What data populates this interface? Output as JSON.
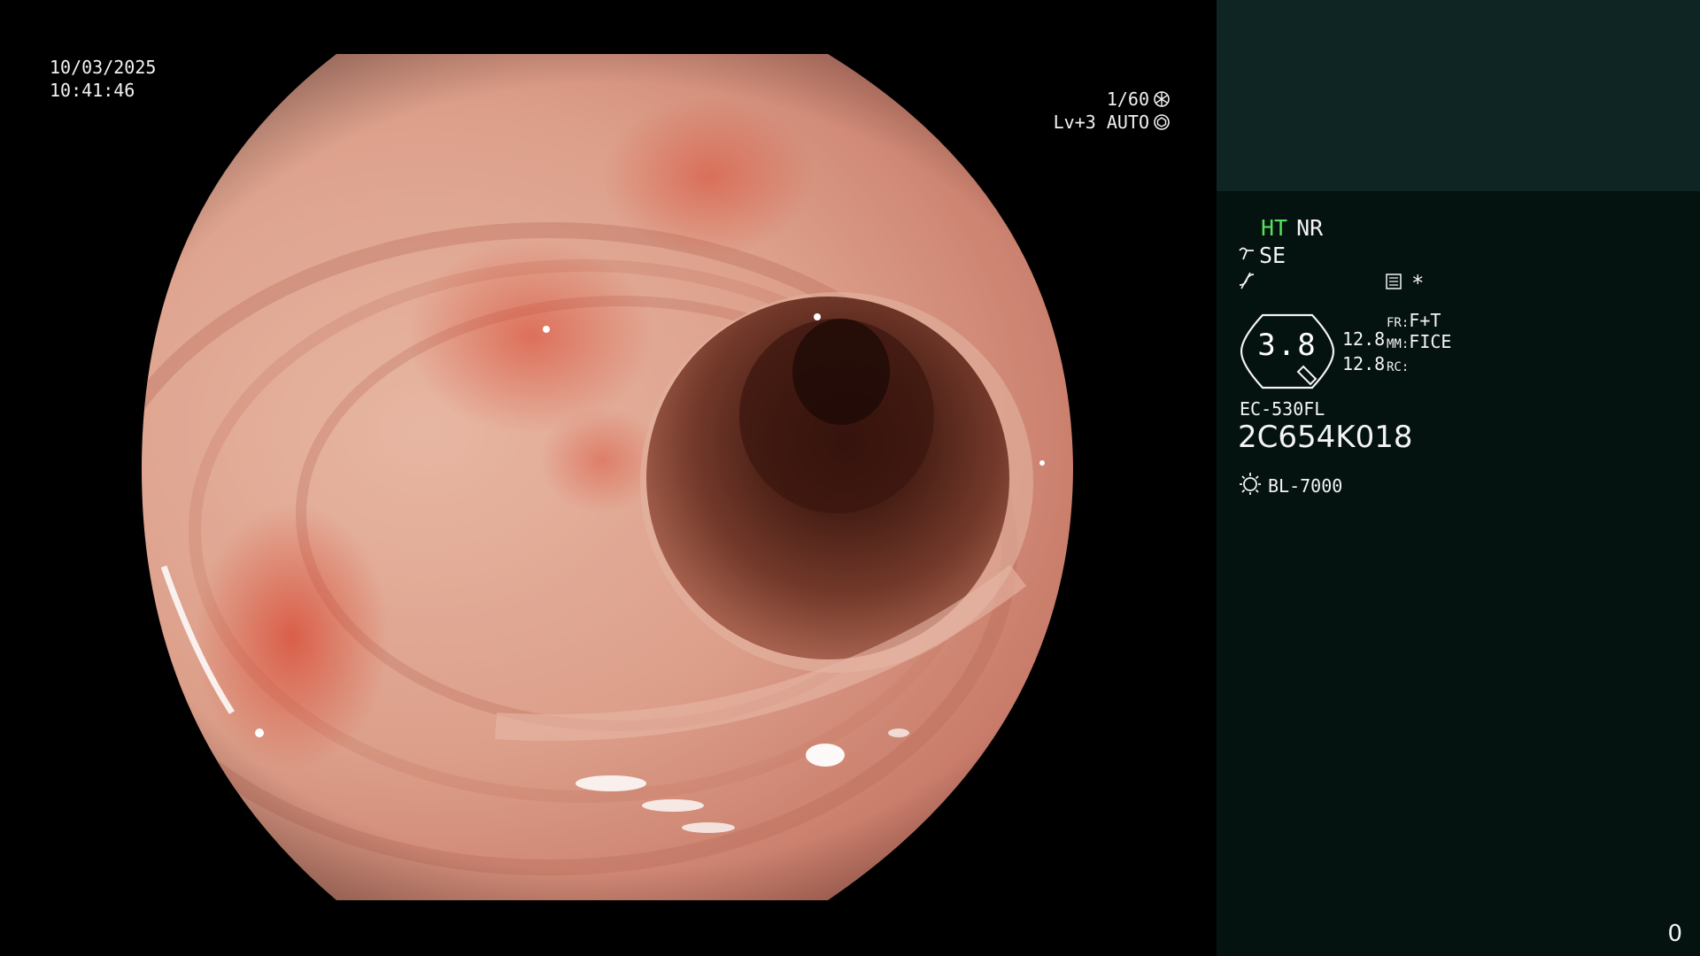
{
  "overlay": {
    "date": "10/03/2025",
    "time": "10:41:46",
    "shutter": "1/60",
    "iris": "Lv+3 AUTO",
    "shutter_icon": "shutter-icon",
    "iris_icon": "iris-icon"
  },
  "panel": {
    "mode_ht": "HT",
    "mode_nr": "NR",
    "se_label": "SE",
    "asterisk": "*",
    "gauge_value": "3.8",
    "value_top": "12.8",
    "value_bottom": "12.8",
    "fr_label": "FR:",
    "fr_value": "F+T",
    "mm_label": "MM:",
    "mm_value": "FICE",
    "rc_label": "RC:",
    "scope_model": "EC-530FL",
    "scope_serial": "2C654K018",
    "light_source": "BL-7000",
    "corner_number": "0"
  },
  "colors": {
    "ht_green": "#56e05c",
    "panel_bg": "#041210",
    "patient_box_bg": "#0e2523"
  }
}
